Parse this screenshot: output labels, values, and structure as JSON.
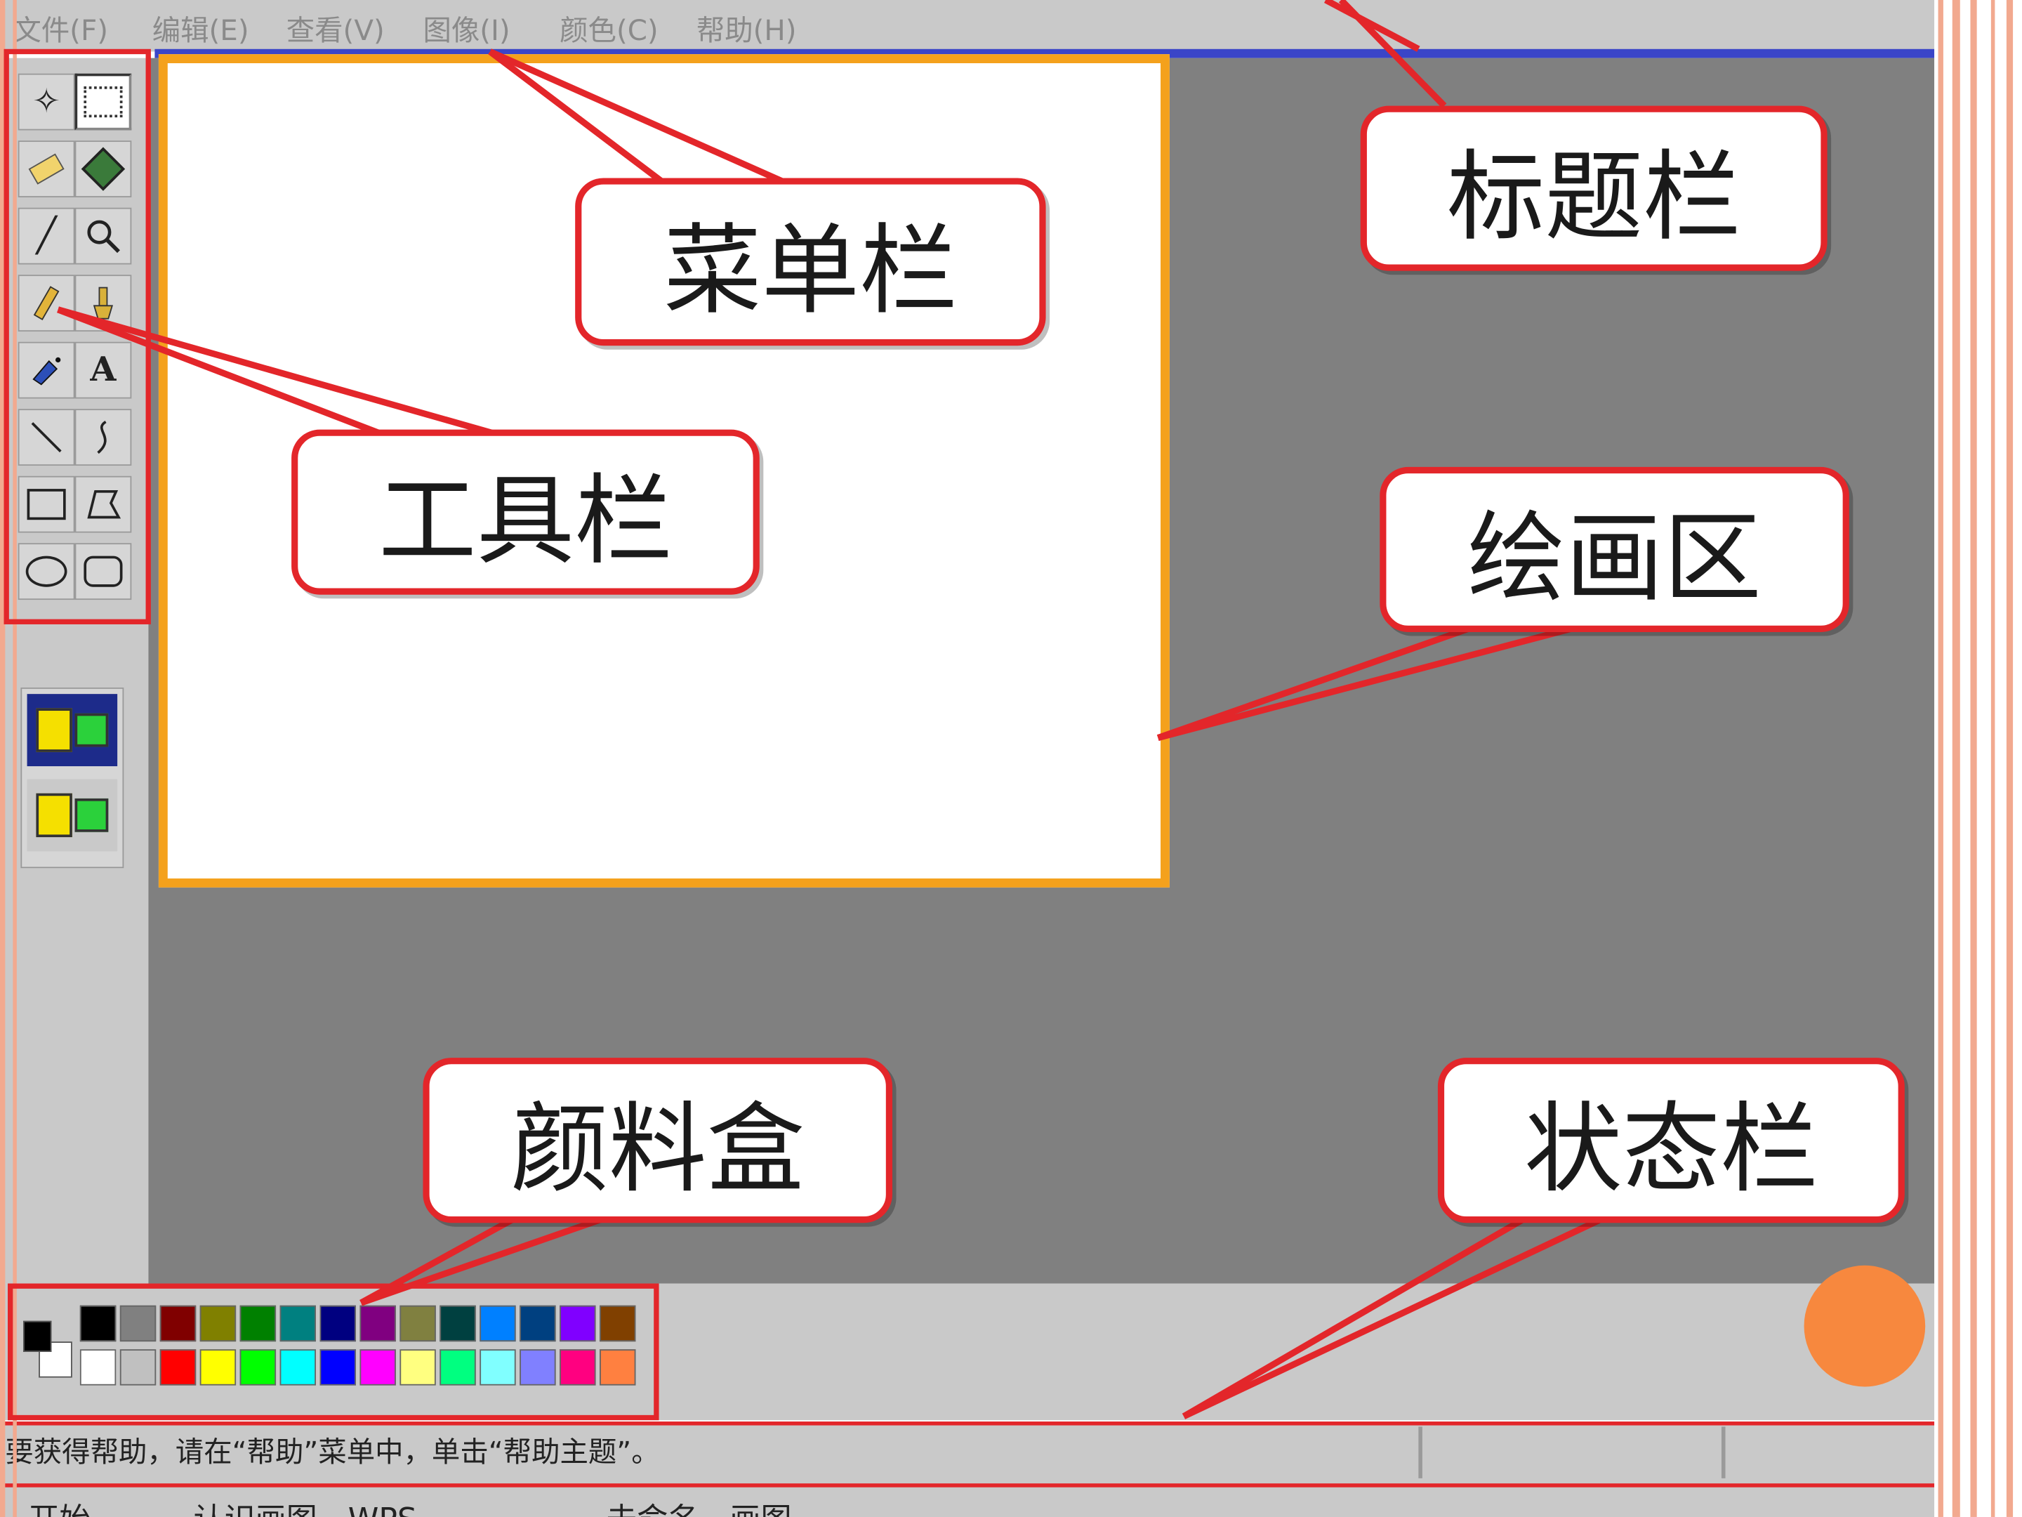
{
  "menu": {
    "items": [
      "文件(F)",
      "编辑(E)",
      "查看(V)",
      "图像(I)",
      "颜色(C)",
      "帮助(H)"
    ]
  },
  "tools": {
    "icons": [
      "free-select-icon",
      "rect-select-icon",
      "eraser-icon",
      "fill-icon",
      "color-picker-icon",
      "magnifier-icon",
      "pencil-icon",
      "brush-icon",
      "airbrush-icon",
      "text-icon",
      "line-icon",
      "curve-icon",
      "rectangle-icon",
      "polygon-icon",
      "ellipse-icon",
      "rounded-rect-icon"
    ],
    "text_tool_label": "A"
  },
  "callouts": {
    "title_bar": "标题栏",
    "menu_bar": "菜单栏",
    "tool_bar": "工具栏",
    "drawing_area": "绘画区",
    "palette": "颜料盒",
    "status_bar": "状态栏"
  },
  "palette": {
    "top_row": [
      "#000000",
      "#808080",
      "#800000",
      "#808000",
      "#008000",
      "#008080",
      "#000080",
      "#800080",
      "#808040",
      "#004040",
      "#0080ff",
      "#004080",
      "#8000ff",
      "#804000"
    ],
    "bottom_row": [
      "#ffffff",
      "#c0c0c0",
      "#ff0000",
      "#ffff00",
      "#00ff00",
      "#00ffff",
      "#0000ff",
      "#ff00ff",
      "#ffff80",
      "#00ff80",
      "#80ffff",
      "#8080ff",
      "#ff0080",
      "#ff8040"
    ],
    "foreground": "#000000",
    "background": "#ffffff"
  },
  "status": {
    "text": "要获得帮助，请在“帮助”菜单中，单击“帮助主题”。"
  },
  "taskbar": {
    "start": "开始",
    "task1": "认识画图 - WPS ...",
    "task2": "未命名 - 画图"
  },
  "colors": {
    "callout_border": "#e3262a",
    "canvas_border": "#f4a11c",
    "workspace": "#808080",
    "accent_dot": "#f7883e"
  }
}
